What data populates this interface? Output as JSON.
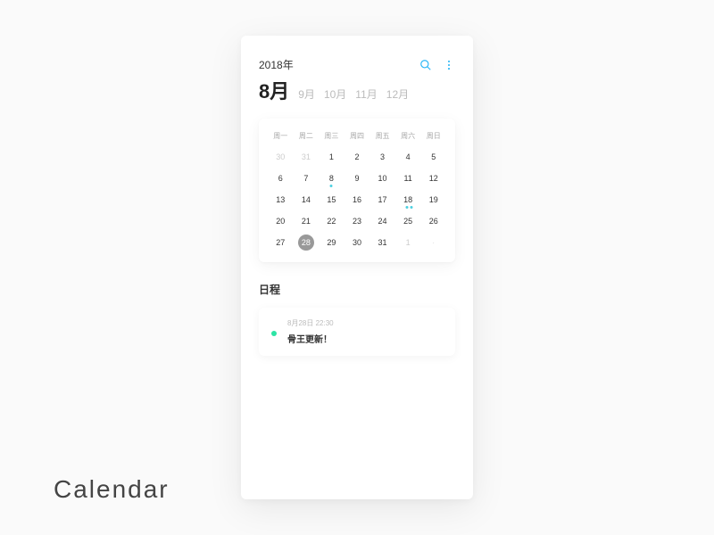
{
  "watermark": "Calendar",
  "header": {
    "year": "2018年",
    "current_month": "8月",
    "other_months": [
      "9月",
      "10月",
      "11月",
      "12月"
    ]
  },
  "calendar": {
    "weekdays": [
      "周一",
      "周二",
      "周三",
      "周四",
      "周五",
      "周六",
      "周日"
    ],
    "cells": [
      {
        "d": "30",
        "muted": true
      },
      {
        "d": "31",
        "muted": true
      },
      {
        "d": "1"
      },
      {
        "d": "2"
      },
      {
        "d": "3"
      },
      {
        "d": "4"
      },
      {
        "d": "5"
      },
      {
        "d": "6"
      },
      {
        "d": "7"
      },
      {
        "d": "8",
        "event": true
      },
      {
        "d": "9"
      },
      {
        "d": "10"
      },
      {
        "d": "11"
      },
      {
        "d": "12"
      },
      {
        "d": "13"
      },
      {
        "d": "14"
      },
      {
        "d": "15"
      },
      {
        "d": "16"
      },
      {
        "d": "17"
      },
      {
        "d": "18",
        "event2": true
      },
      {
        "d": "19"
      },
      {
        "d": "20"
      },
      {
        "d": "21"
      },
      {
        "d": "22"
      },
      {
        "d": "23"
      },
      {
        "d": "24"
      },
      {
        "d": "25"
      },
      {
        "d": "26"
      },
      {
        "d": "27"
      },
      {
        "d": "28",
        "selected": true
      },
      {
        "d": "29"
      },
      {
        "d": "30"
      },
      {
        "d": "31"
      },
      {
        "d": "1",
        "muted": true
      },
      {
        "d": ".",
        "tiny": true
      }
    ]
  },
  "schedule": {
    "title": "日程",
    "event": {
      "time": "8月28日  22:30",
      "title": "骨王更新！"
    }
  }
}
